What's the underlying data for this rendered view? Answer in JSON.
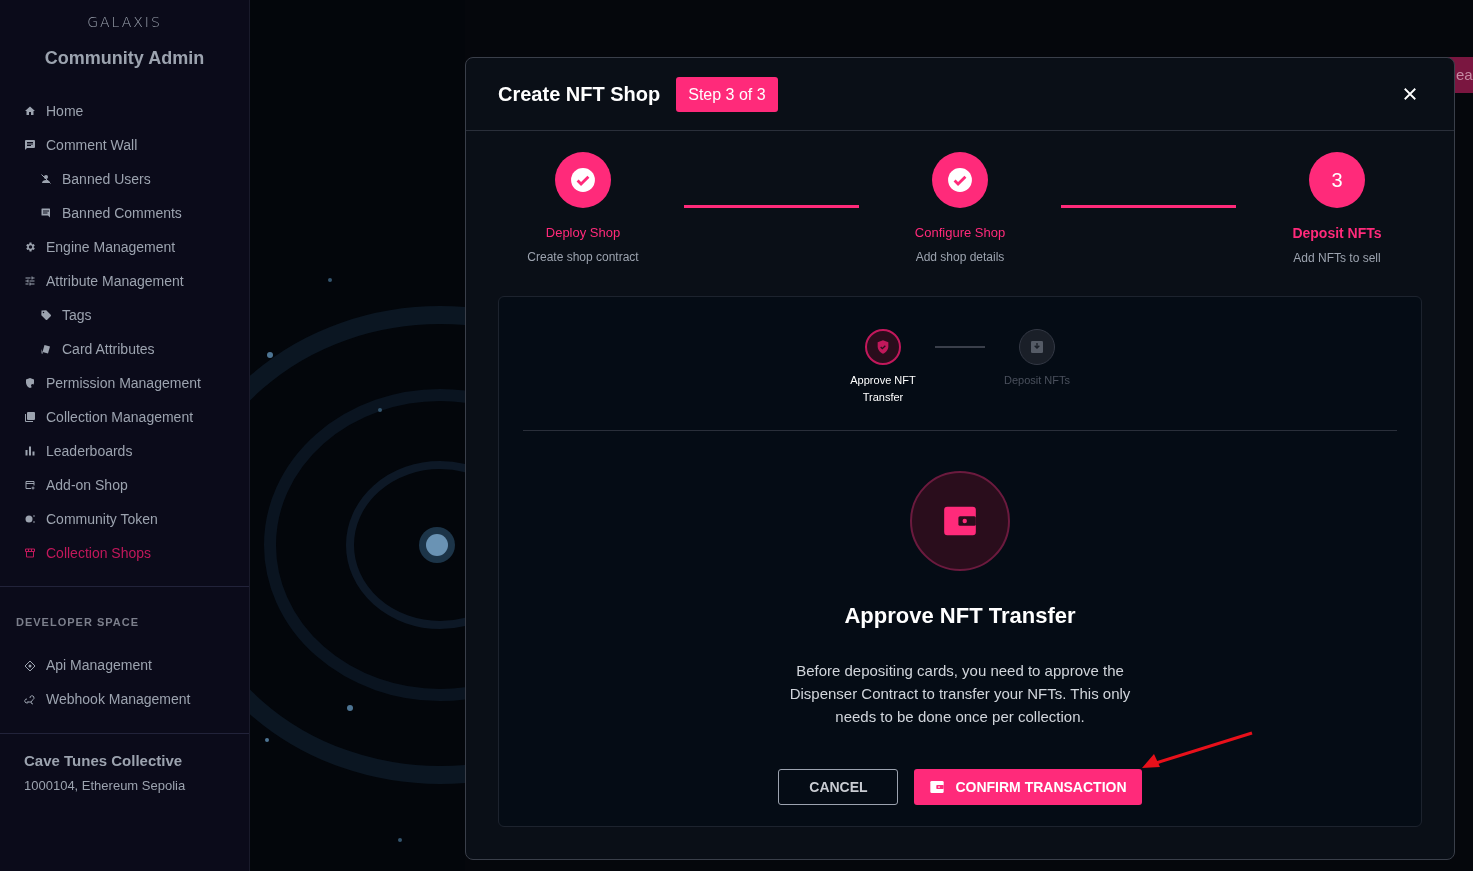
{
  "sidebar": {
    "logo": "GALAXIS",
    "title": "Community Admin",
    "items": [
      {
        "label": "Home",
        "selected": false
      },
      {
        "label": "Comment Wall",
        "selected": false,
        "children": [
          {
            "label": "Banned Users",
            "selected": false
          },
          {
            "label": "Banned Comments",
            "selected": false
          }
        ]
      },
      {
        "label": "Engine Management",
        "selected": false
      },
      {
        "label": "Attribute Management",
        "selected": false,
        "children": [
          {
            "label": "Tags",
            "selected": false
          },
          {
            "label": "Card Attributes",
            "selected": false
          }
        ]
      },
      {
        "label": "Permission Management",
        "selected": false
      },
      {
        "label": "Collection Management",
        "selected": false
      },
      {
        "label": "Leaderboards",
        "selected": false
      },
      {
        "label": "Add-on Shop",
        "selected": false
      },
      {
        "label": "Community Token",
        "selected": false
      },
      {
        "label": "Collection Shops",
        "selected": true
      }
    ],
    "section_heading": "DEVELOPER SPACE",
    "developer_items": [
      {
        "label": "Api Management",
        "selected": false
      },
      {
        "label": "Webhook Management",
        "selected": false
      }
    ],
    "community": {
      "name": "Cave Tunes Collective",
      "details": "1000104, Ethereum Sepolia"
    }
  },
  "background": {
    "kind": "picture",
    "button_label": "ea"
  },
  "modal": {
    "title": "Create NFT Shop",
    "badge": "Step 3 of 3",
    "steps": [
      {
        "label": "Deploy Shop",
        "sublabel": "Create shop contract",
        "kind": "done"
      },
      {
        "label": "Configure Shop",
        "sublabel": "Add shop details",
        "kind": "done"
      },
      {
        "label": "Deposit NFTs",
        "sublabel": "Add NFTs to sell",
        "kind": "current",
        "number": "3"
      }
    ],
    "substeps": [
      {
        "label": "Approve NFT Transfer",
        "selected": true
      },
      {
        "label": "Deposit NFTs",
        "selected": false
      }
    ],
    "heading": "Approve NFT Transfer",
    "description": "Before depositing cards, you need to approve the Dispenser Contract to transfer your NFTs. This only needs to be done once per collection.",
    "cancel": "CANCEL",
    "confirm": "CONFIRM TRANSACTION"
  }
}
